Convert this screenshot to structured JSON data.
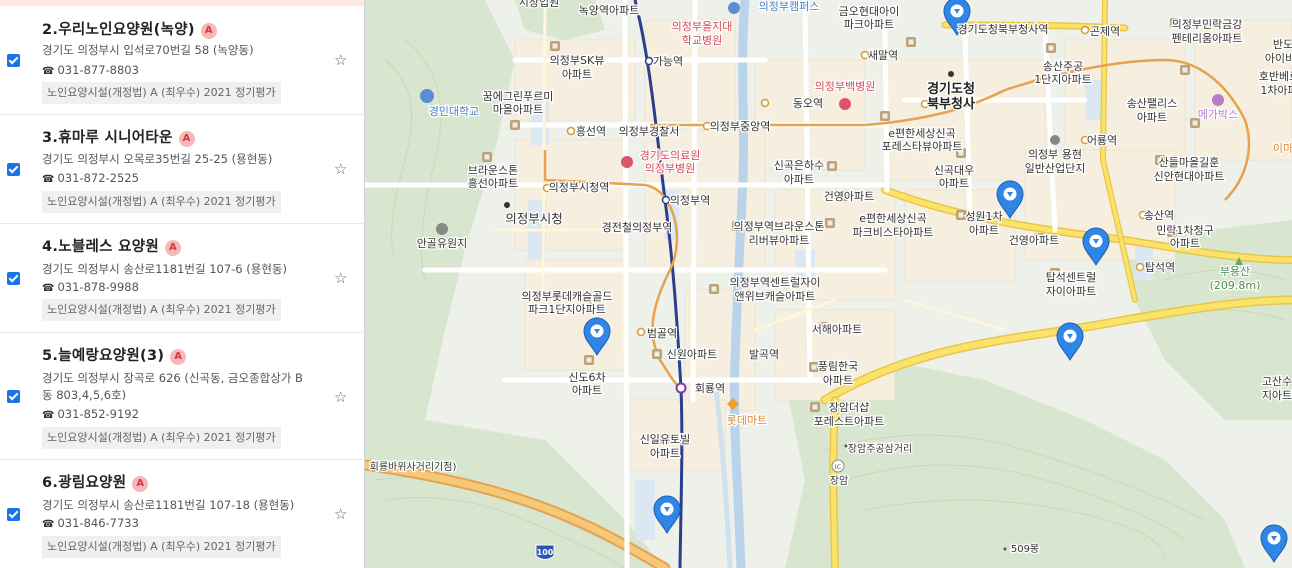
{
  "list": {
    "items": [
      {
        "title": "2.우리노인요양원(녹양)",
        "badge": "A",
        "address": "경기도 의정부시 입석로70번길 58 (녹양동)",
        "phone": "031-877-8803",
        "tag": "노인요양시설(개정법) A (최우수) 2021 정기평가"
      },
      {
        "title": "3.휴마루 시니어타운",
        "badge": "A",
        "address": "경기도 의정부시 오목로35번길 25-25 (용현동)",
        "phone": "031-872-2525",
        "tag": "노인요양시설(개정법) A (최우수) 2021 정기평가"
      },
      {
        "title": "4.노블레스 요양원",
        "badge": "A",
        "address": "경기도 의정부시 송산로1181번길 107-6 (용현동)",
        "phone": "031-878-9988",
        "tag": "노인요양시설(개정법) A (최우수) 2021 정기평가"
      },
      {
        "title": "5.늘예랑요양원(3)",
        "badge": "A",
        "address": "경기도 의정부시 장곡로 626 (신곡동, 금오종합상가 B동 803,4,5,6호)",
        "phone": "031-852-9192",
        "tag": "노인요양시설(개정법) A (최우수) 2021 정기평가"
      },
      {
        "title": "6.광림요양원",
        "badge": "A",
        "address": "경기도 의정부시 송산로1181번길 107-18 (용현동)",
        "phone": "031-846-7733",
        "tag": "노인요양시설(개정법) A (최우수) 2021 정기평가"
      }
    ]
  },
  "map": {
    "labels": {
      "l1": "녹양역아파트",
      "l2": "시장입원",
      "l3": "의정부을지대",
      "l4": "학교병원",
      "l5": "의정부캠퍼스",
      "l6": "금오현대아이",
      "l7": "파크아파트",
      "l8": "경기도청북부청사역",
      "l9": "곤제역",
      "l10": "의정부민락금강",
      "l11": "펜테리움아파트",
      "l12": "반도",
      "l13": "아이비",
      "l14": "가능역",
      "l15": "새말역",
      "l16": "의정부SK뷰",
      "l17": "아파트",
      "l18": "경기도청",
      "l19": "북부청사",
      "l20": "송산주공",
      "l21": "1단지아파트",
      "l22": "호반베르",
      "l23": "1차아파",
      "l24": "꿈에그린푸르미",
      "l25": "마을아파트",
      "l26": "경민대학교",
      "l27": "의정부백병원",
      "l28": "동오역",
      "l29": "송산팰리스",
      "l30": "아파트",
      "l31": "메가박스",
      "l32": "흥선역",
      "l33": "의정부경찰서",
      "l34": "의정부중앙역",
      "l35": "e편한세상신곡",
      "l36": "포레스타뷰아파트",
      "l37": "어룡역",
      "l38": "의정부 용현",
      "l39": "일반산업단지",
      "l40": "경기도의료원",
      "l41": "의정부병원",
      "l42": "브라운스톤",
      "l43": "흥선아파트",
      "l44": "신곡은하수",
      "l45": "아파트",
      "l46": "신곡대우",
      "l47": "아파트",
      "l48": "산들마을길훈",
      "l49": "신안현대아파트",
      "l50": "이마",
      "l51": "의정부시청역",
      "l52": "건영아파트",
      "l53": "의정부시청",
      "l54": "의정부역",
      "l55": "송산역",
      "l56": "e편한세상신곡",
      "l57": "파크비스타아파트",
      "l58": "성원1차",
      "l59": "아파트",
      "l60": "건영아파트",
      "l61": "민락1차청구",
      "l62": "아파트",
      "l63": "경전철의정부역",
      "l64": "의정부역브라운스톤",
      "l65": "리버뷰아파트",
      "l66": "안골유원지",
      "l67": "탑석역",
      "l68": "부용산",
      "l69": "(209.8m)",
      "l70": "탑석센트럴",
      "l71": "자이아파트",
      "l72": "의정부롯데캐슬골드",
      "l73": "파크1단지아파트",
      "l74": "의정부역센트럴자이",
      "l75": "앤위브캐슬아파트",
      "l76": "서해아파트",
      "l77": "범골역",
      "l78": "신원아파트",
      "l79": "발곡역",
      "l80": "신도6차",
      "l81": "아파트",
      "l82": "풍림한국",
      "l83": "아파트",
      "l84": "고산수",
      "l85": "지아트",
      "l86": "회룡역",
      "l87": "롯데마트",
      "l88": "장암더샵",
      "l89": "포레스트아파트",
      "l90": "장암주공삼거리",
      "l91": "신일유토빌",
      "l92": "아파트",
      "l93": "회룡바위사거리기점)",
      "l94": "장암",
      "l95": "509봉",
      "l96": "100",
      "l97": "IC"
    }
  }
}
